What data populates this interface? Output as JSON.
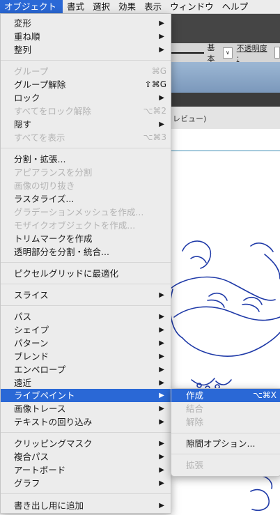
{
  "menubar": {
    "items": [
      {
        "label": "オブジェクト"
      },
      {
        "label": "書式"
      },
      {
        "label": "選択"
      },
      {
        "label": "効果"
      },
      {
        "label": "表示"
      },
      {
        "label": "ウィンドウ"
      },
      {
        "label": "ヘルプ"
      }
    ]
  },
  "app": {
    "stroke_style": "基本",
    "stroke_select_arrow": "∨",
    "opacity_label": "不透明度 :",
    "tab_fragment": "レビュー)"
  },
  "object_menu": {
    "items": [
      {
        "label": "変形",
        "submenu": true
      },
      {
        "label": "重ね順",
        "submenu": true
      },
      {
        "label": "整列",
        "submenu": true
      },
      {
        "label": "グループ",
        "shortcut": "⌘G",
        "disabled": true
      },
      {
        "label": "グループ解除",
        "shortcut": "⇧⌘G"
      },
      {
        "label": "ロック",
        "submenu": true
      },
      {
        "label": "すべてをロック解除",
        "shortcut": "⌥⌘2",
        "disabled": true
      },
      {
        "label": "隠す",
        "submenu": true
      },
      {
        "label": "すべてを表示",
        "shortcut": "⌥⌘3",
        "disabled": true
      },
      {
        "label": "分割・拡張..."
      },
      {
        "label": "アピアランスを分割",
        "disabled": true
      },
      {
        "label": "画像の切り抜き",
        "disabled": true
      },
      {
        "label": "ラスタライズ..."
      },
      {
        "label": "グラデーションメッシュを作成...",
        "disabled": true
      },
      {
        "label": "モザイクオブジェクトを作成...",
        "disabled": true
      },
      {
        "label": "トリムマークを作成"
      },
      {
        "label": "透明部分を分割・統合..."
      },
      {
        "label": "ピクセルグリッドに最適化"
      },
      {
        "label": "スライス",
        "submenu": true
      },
      {
        "label": "パス",
        "submenu": true
      },
      {
        "label": "シェイプ",
        "submenu": true
      },
      {
        "label": "パターン",
        "submenu": true
      },
      {
        "label": "ブレンド",
        "submenu": true
      },
      {
        "label": "エンベロープ",
        "submenu": true
      },
      {
        "label": "遠近",
        "submenu": true
      },
      {
        "label": "ライブペイント",
        "submenu": true,
        "highlighted": true
      },
      {
        "label": "画像トレース",
        "submenu": true
      },
      {
        "label": "テキストの回り込み",
        "submenu": true
      },
      {
        "label": "クリッピングマスク",
        "submenu": true
      },
      {
        "label": "複合パス",
        "submenu": true
      },
      {
        "label": "アートボード",
        "submenu": true
      },
      {
        "label": "グラフ",
        "submenu": true
      },
      {
        "label": "書き出し用に追加",
        "submenu": true
      }
    ],
    "submenu_arrow": "▶"
  },
  "livepaint_submenu": {
    "items": [
      {
        "label": "作成",
        "shortcut": "⌥⌘X",
        "highlighted": true
      },
      {
        "label": "結合",
        "disabled": true
      },
      {
        "label": "解除",
        "disabled": true
      },
      {
        "label": "隙間オプション..."
      },
      {
        "label": "拡張",
        "disabled": true
      }
    ]
  }
}
